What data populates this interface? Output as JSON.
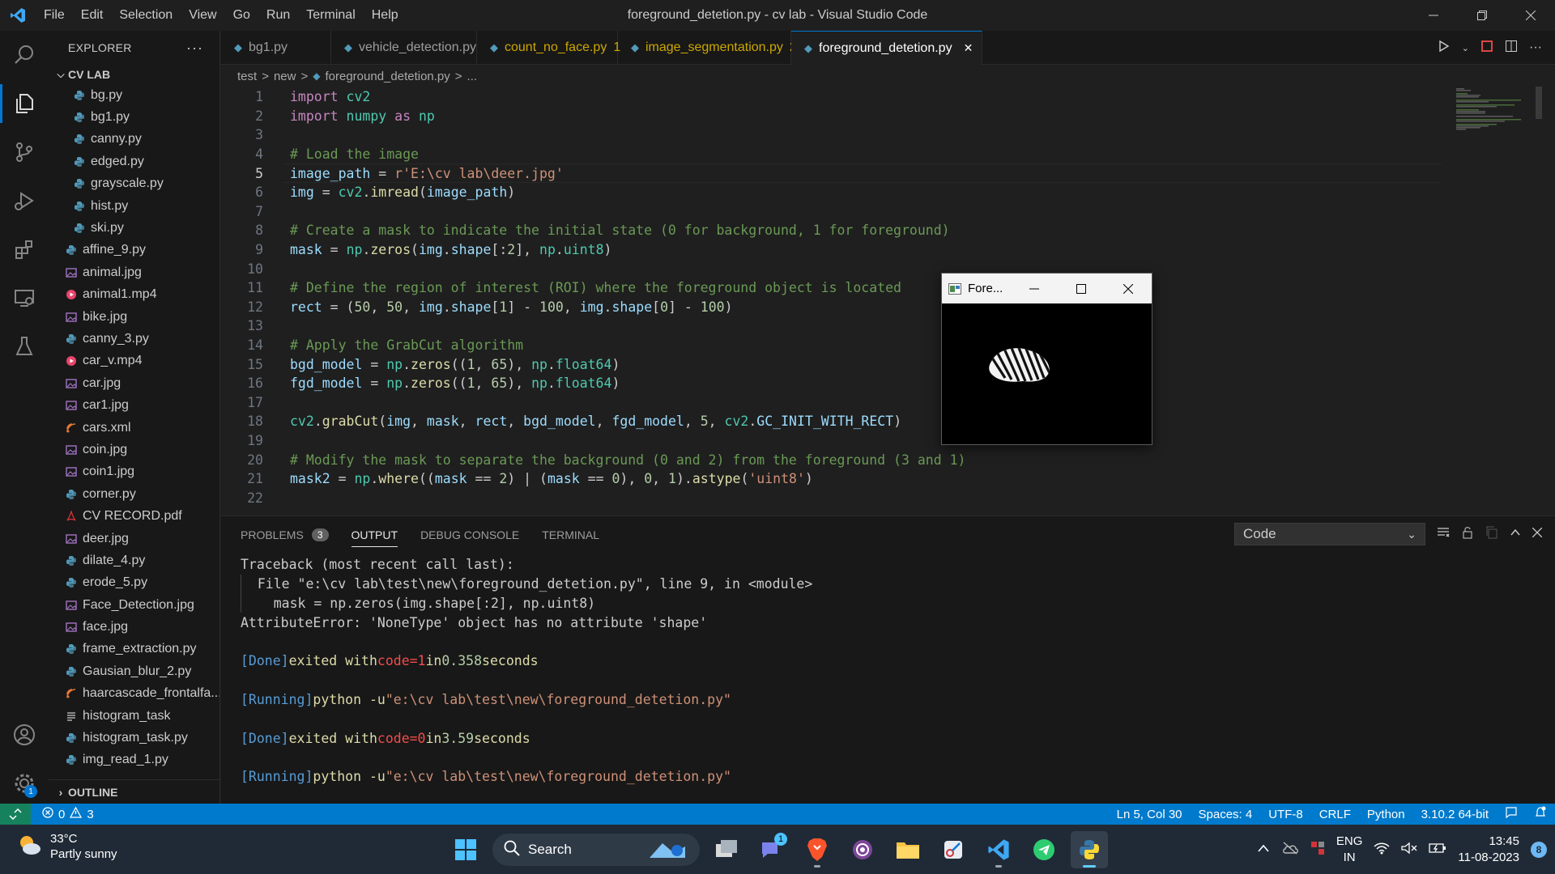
{
  "titlebar": {
    "menu": [
      "File",
      "Edit",
      "Selection",
      "View",
      "Go",
      "Run",
      "Terminal",
      "Help"
    ],
    "title": "foreground_detetion.py - cv lab - Visual Studio Code"
  },
  "sidebar": {
    "header": "EXPLORER",
    "root": "CV LAB",
    "outline": "OUTLINE",
    "files": [
      {
        "name": "bg.py",
        "type": "py",
        "level": 2
      },
      {
        "name": "bg1.py",
        "type": "py",
        "level": 2
      },
      {
        "name": "canny.py",
        "type": "py",
        "level": 2
      },
      {
        "name": "edged.py",
        "type": "py",
        "level": 2
      },
      {
        "name": "grayscale.py",
        "type": "py",
        "level": 2
      },
      {
        "name": "hist.py",
        "type": "py",
        "level": 2
      },
      {
        "name": "ski.py",
        "type": "py",
        "level": 2
      },
      {
        "name": "affine_9.py",
        "type": "py",
        "level": 1
      },
      {
        "name": "animal.jpg",
        "type": "img",
        "level": 1
      },
      {
        "name": "animal1.mp4",
        "type": "vid",
        "level": 1
      },
      {
        "name": "bike.jpg",
        "type": "img",
        "level": 1
      },
      {
        "name": "canny_3.py",
        "type": "py",
        "level": 1
      },
      {
        "name": "car_v.mp4",
        "type": "vid",
        "level": 1
      },
      {
        "name": "car.jpg",
        "type": "img",
        "level": 1
      },
      {
        "name": "car1.jpg",
        "type": "img",
        "level": 1
      },
      {
        "name": "cars.xml",
        "type": "xml",
        "level": 1
      },
      {
        "name": "coin.jpg",
        "type": "img",
        "level": 1
      },
      {
        "name": "coin1.jpg",
        "type": "img",
        "level": 1
      },
      {
        "name": "corner.py",
        "type": "py",
        "level": 1
      },
      {
        "name": "CV RECORD.pdf",
        "type": "pdf",
        "level": 1
      },
      {
        "name": "deer.jpg",
        "type": "img",
        "level": 1
      },
      {
        "name": "dilate_4.py",
        "type": "py",
        "level": 1
      },
      {
        "name": "erode_5.py",
        "type": "py",
        "level": 1
      },
      {
        "name": "Face_Detection.jpg",
        "type": "img",
        "level": 1
      },
      {
        "name": "face.jpg",
        "type": "img",
        "level": 1
      },
      {
        "name": "frame_extraction.py",
        "type": "py",
        "level": 1
      },
      {
        "name": "Gausian_blur_2.py",
        "type": "py",
        "level": 1
      },
      {
        "name": "haarcascade_frontalfa...",
        "type": "xml",
        "level": 1
      },
      {
        "name": "histogram_task",
        "type": "txt",
        "level": 1
      },
      {
        "name": "histogram_task.py",
        "type": "py",
        "level": 1
      },
      {
        "name": "img_read_1.py",
        "type": "py",
        "level": 1
      }
    ]
  },
  "tabs": [
    {
      "label": "bg1.py",
      "state": "normal",
      "badge": ""
    },
    {
      "label": "vehicle_detection.py",
      "state": "normal",
      "badge": ""
    },
    {
      "label": "count_no_face.py",
      "state": "warn",
      "badge": "1"
    },
    {
      "label": "image_segmentation.py",
      "state": "warn",
      "badge": "2"
    },
    {
      "label": "foreground_detetion.py",
      "state": "active",
      "badge": ""
    }
  ],
  "breadcrumb": [
    "test",
    ">",
    "new",
    ">",
    "foreground_detetion.py",
    ">",
    "..."
  ],
  "editor": {
    "lines": [
      {
        "n": "1",
        "html": "<span class=\"kw\">import</span> <span class=\"mod\">cv2</span>"
      },
      {
        "n": "2",
        "html": "<span class=\"kw\">import</span> <span class=\"mod\">numpy</span> <span class=\"kw\">as</span> <span class=\"mod\">np</span>"
      },
      {
        "n": "3",
        "html": ""
      },
      {
        "n": "4",
        "html": "<span class=\"cm\"># Load the image</span>"
      },
      {
        "n": "5",
        "html": "<span class=\"var\">image_path</span> = <span class=\"str\">r'E:\\cv lab\\deer.jpg'</span>"
      },
      {
        "n": "6",
        "html": "<span class=\"var\">img</span> = <span class=\"mod\">cv2</span>.<span class=\"fn\">imread</span>(<span class=\"var\">image_path</span>)"
      },
      {
        "n": "7",
        "html": ""
      },
      {
        "n": "8",
        "html": "<span class=\"cm\"># Create a mask to indicate the initial state (0 for background, 1 for foreground)</span>"
      },
      {
        "n": "9",
        "html": "<span class=\"var\">mask</span> = <span class=\"mod\">np</span>.<span class=\"fn\">zeros</span>(<span class=\"var\">img</span>.<span class=\"var\">shape</span>[:<span class=\"num\">2</span>], <span class=\"mod\">np</span>.<span class=\"mod\">uint8</span>)"
      },
      {
        "n": "10",
        "html": ""
      },
      {
        "n": "11",
        "html": "<span class=\"cm\"># Define the region of interest (ROI) where the foreground object is located</span>"
      },
      {
        "n": "12",
        "html": "<span class=\"var\">rect</span> = (<span class=\"num\">50</span>, <span class=\"num\">50</span>, <span class=\"var\">img</span>.<span class=\"var\">shape</span>[<span class=\"num\">1</span>] - <span class=\"num\">100</span>, <span class=\"var\">img</span>.<span class=\"var\">shape</span>[<span class=\"num\">0</span>] - <span class=\"num\">100</span>)"
      },
      {
        "n": "13",
        "html": ""
      },
      {
        "n": "14",
        "html": "<span class=\"cm\"># Apply the GrabCut algorithm</span>"
      },
      {
        "n": "15",
        "html": "<span class=\"var\">bgd_model</span> = <span class=\"mod\">np</span>.<span class=\"fn\">zeros</span>((<span class=\"num\">1</span>, <span class=\"num\">65</span>), <span class=\"mod\">np</span>.<span class=\"mod\">float64</span>)"
      },
      {
        "n": "16",
        "html": "<span class=\"var\">fgd_model</span> = <span class=\"mod\">np</span>.<span class=\"fn\">zeros</span>((<span class=\"num\">1</span>, <span class=\"num\">65</span>), <span class=\"mod\">np</span>.<span class=\"mod\">float64</span>)"
      },
      {
        "n": "17",
        "html": ""
      },
      {
        "n": "18",
        "html": "<span class=\"mod\">cv2</span>.<span class=\"fn\">grabCut</span>(<span class=\"var\">img</span>, <span class=\"var\">mask</span>, <span class=\"var\">rect</span>, <span class=\"var\">bgd_model</span>, <span class=\"var\">fgd_model</span>, <span class=\"num\">5</span>, <span class=\"mod\">cv2</span>.<span class=\"var\">GC_INIT_WITH_RECT</span>)"
      },
      {
        "n": "19",
        "html": ""
      },
      {
        "n": "20",
        "html": "<span class=\"cm\"># Modify the mask to separate the background (0 and 2) from the foreground (3 and 1)</span>"
      },
      {
        "n": "21",
        "html": "<span class=\"var\">mask2</span> = <span class=\"mod\">np</span>.<span class=\"fn\">where</span>((<span class=\"var\">mask</span> == <span class=\"num\">2</span>) | (<span class=\"var\">mask</span> == <span class=\"num\">0</span>), <span class=\"num\">0</span>, <span class=\"num\">1</span>).<span class=\"fn\">astype</span>(<span class=\"str\">'uint8'</span>)"
      },
      {
        "n": "22",
        "html": ""
      }
    ],
    "current_line": 5
  },
  "panel": {
    "tabs": [
      {
        "label": "PROBLEMS",
        "badge": "3",
        "active": false
      },
      {
        "label": "OUTPUT",
        "badge": "",
        "active": true
      },
      {
        "label": "DEBUG CONSOLE",
        "badge": "",
        "active": false
      },
      {
        "label": "TERMINAL",
        "badge": "",
        "active": false
      }
    ],
    "channel": "Code",
    "output": [
      {
        "html": "Traceback (most recent call last):"
      },
      {
        "html": "  File \"e:\\cv lab\\test\\new\\foreground_detetion.py\", line 9, in &lt;module&gt;"
      },
      {
        "html": "    mask = np.zeros(img.shape[:2], np.uint8)"
      },
      {
        "html": "AttributeError: 'NoneType' object has no attribute 'shape'"
      },
      {
        "html": ""
      },
      {
        "html": "<span class=\"o-blue\">[Done]</span> <span class=\"o-yellow\">exited with</span> <span class=\"o-red\">code=1</span> <span class=\"o-yellow\">in</span> <span class=\"o-green\">0.358</span> <span class=\"o-yellow\">seconds</span>"
      },
      {
        "html": ""
      },
      {
        "html": "<span class=\"o-blue\">[Running]</span> <span class=\"o-yellow\">python -u</span> <span class=\"o-orange\">\"e:\\cv lab\\test\\new\\foreground_detetion.py\"</span>"
      },
      {
        "html": ""
      },
      {
        "html": "<span class=\"o-blue\">[Done]</span> <span class=\"o-yellow\">exited with</span> <span class=\"o-red\">code=0</span> <span class=\"o-yellow\">in</span> <span class=\"o-green\">3.59</span> <span class=\"o-yellow\">seconds</span>"
      },
      {
        "html": ""
      },
      {
        "html": "<span class=\"o-blue\">[Running]</span> <span class=\"o-yellow\">python -u</span> <span class=\"o-orange\">\"e:\\cv lab\\test\\new\\foreground_detetion.py\"</span>"
      }
    ]
  },
  "popup": {
    "title": "Fore..."
  },
  "statusbar": {
    "errors": "0",
    "warnings": "3",
    "position": "Ln 5, Col 30",
    "spaces": "Spaces: 4",
    "encoding": "UTF-8",
    "eol": "CRLF",
    "language": "Python",
    "interpreter": "3.10.2 64-bit"
  },
  "taskbar": {
    "temperature": "33°C",
    "weather": "Partly sunny",
    "search": "Search",
    "lang_line1": "ENG",
    "lang_line2": "IN",
    "time": "13:45",
    "date": "11-08-2023",
    "notification_count": "8",
    "teams_badge": "1"
  },
  "colors": {
    "accent": "#0078d4",
    "statusbar": "#007acc",
    "warning": "#cca700"
  }
}
